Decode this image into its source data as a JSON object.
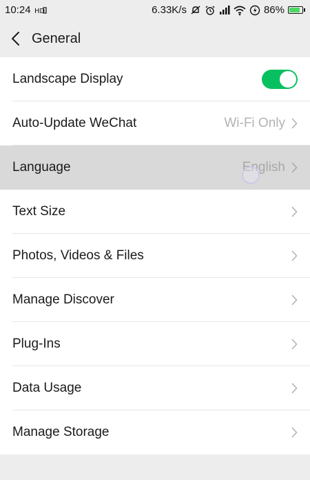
{
  "status_bar": {
    "time": "10:24",
    "hd_label": "HD",
    "speed": "6.33K/s",
    "battery": "86%",
    "battery_level": 0.86,
    "battery_color": "#4cd964"
  },
  "header": {
    "title": "General",
    "back_icon": "chevron-left-icon"
  },
  "settings": {
    "items": [
      {
        "label": "Landscape Display",
        "value": "",
        "control": "toggle",
        "toggle_on": true
      },
      {
        "label": "Auto-Update WeChat",
        "value": "Wi-Fi Only",
        "control": "chevron"
      },
      {
        "label": "Language",
        "value": "English",
        "control": "chevron",
        "pressed": true
      },
      {
        "label": "Text Size",
        "value": "",
        "control": "chevron"
      },
      {
        "label": "Photos, Videos & Files",
        "value": "",
        "control": "chevron"
      },
      {
        "label": "Manage Discover",
        "value": "",
        "control": "chevron"
      },
      {
        "label": "Plug-Ins",
        "value": "",
        "control": "chevron"
      },
      {
        "label": "Data Usage",
        "value": "",
        "control": "chevron"
      },
      {
        "label": "Manage Storage",
        "value": "",
        "control": "chevron"
      }
    ]
  },
  "colors": {
    "accent_toggle": "#07c160",
    "background": "#ededed",
    "row_background": "#ffffff",
    "pressed_row": "#d9d9d9",
    "value_text": "#b2b2b2"
  }
}
